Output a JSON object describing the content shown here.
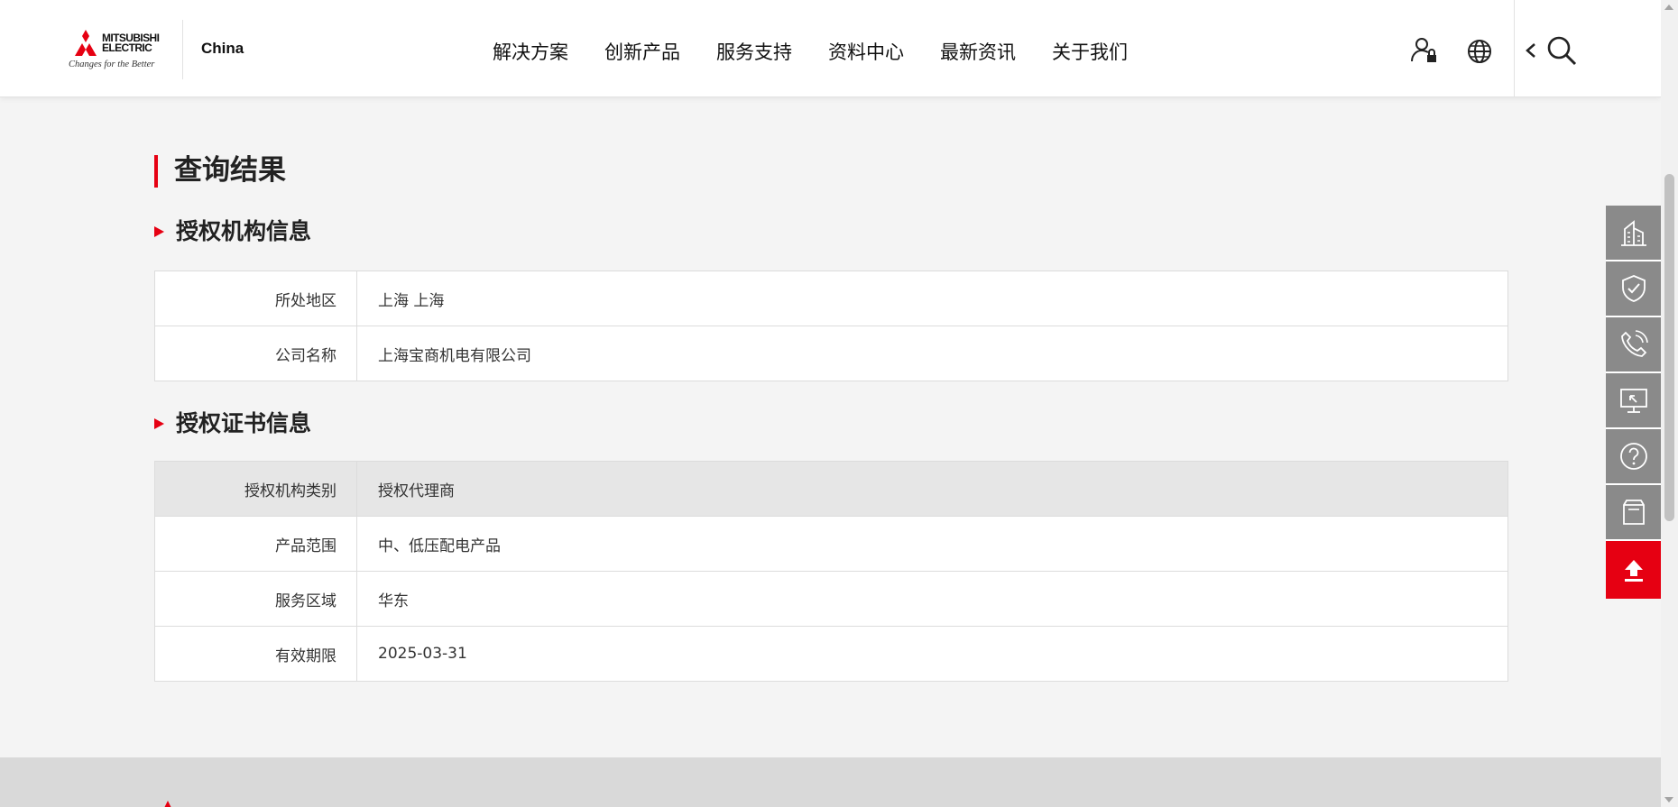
{
  "header": {
    "brand_line1": "MITSUBISHI",
    "brand_line2": "ELECTRIC",
    "brand_tagline": "Changes for the Better",
    "region": "China",
    "nav": [
      "解决方案",
      "创新产品",
      "服务支持",
      "资料中心",
      "最新资讯",
      "关于我们"
    ],
    "icons": [
      "user-lock-icon",
      "globe-icon",
      "chevron-left-icon",
      "search-icon"
    ]
  },
  "page": {
    "title": "查询结果"
  },
  "org_section": {
    "title": "授权机构信息",
    "rows": [
      {
        "label": "所处地区",
        "value": "上海 上海"
      },
      {
        "label": "公司名称",
        "value": "上海宝商机电有限公司"
      }
    ]
  },
  "cert_section": {
    "title": "授权证书信息",
    "rows": [
      {
        "label": "授权机构类别",
        "value": "授权代理商"
      },
      {
        "label": "产品范围",
        "value": "中、低压配电产品"
      },
      {
        "label": "服务区域",
        "value": "华东"
      },
      {
        "label": "有效期限",
        "value": "2025-03-31"
      }
    ]
  },
  "side_toolbar": {
    "items": [
      "building-icon",
      "shield-check-icon",
      "phone-icon",
      "monitor-icon",
      "help-icon",
      "archive-icon",
      "back-to-top-icon"
    ]
  },
  "colors": {
    "accent": "#e60012",
    "side_button": "#8a8a8a",
    "page_bg": "#f4f4f4",
    "table_head": "#e6e6e6"
  }
}
